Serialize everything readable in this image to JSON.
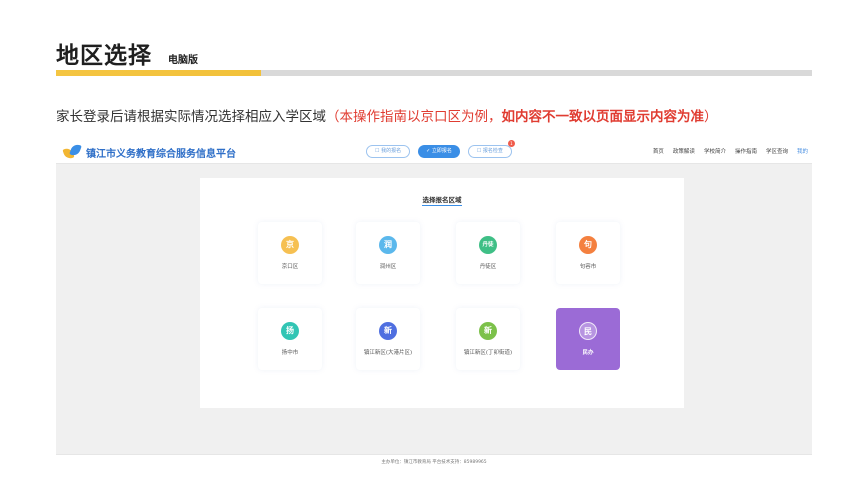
{
  "slide": {
    "title": "地区选择",
    "subtitle": "电脑版",
    "instruction_black": "家长登录后请根据实际情况选择相应入学区域",
    "instruction_red": "（本操作指南以京口区为例，",
    "instruction_red_bold": "如内容不一致以页面显示内容为准",
    "instruction_red_close": "）",
    "colors": {
      "accent_bar": "#f4c542",
      "red": "#e03c31"
    }
  },
  "app": {
    "brand": "镇江市义务教育综合服务信息平台",
    "pills": [
      {
        "label": "☐ 我的报名",
        "icon": "document-icon"
      },
      {
        "label": "✓ 立即报名",
        "icon": "check-icon"
      },
      {
        "label": "☐ 报名检查",
        "icon": "document-icon",
        "badge": "1"
      }
    ],
    "nav": [
      "首页",
      "政策解读",
      "学校简介",
      "操作指南",
      "学区查询",
      "我的"
    ],
    "card_title": "选择报名区域",
    "regions": [
      {
        "char": "京",
        "label": "京口区",
        "color": "#f6c052"
      },
      {
        "char": "润",
        "label": "润州区",
        "color": "#5bb8ec"
      },
      {
        "char": "丹徒",
        "label": "丹徒区",
        "color": "#3fbf86"
      },
      {
        "char": "句",
        "label": "句容市",
        "color": "#f4803f"
      },
      {
        "char": "扬",
        "label": "扬中市",
        "color": "#32c5b4"
      },
      {
        "char": "新",
        "label": "镇江新区(大港片区)",
        "color": "#4f6fe0"
      },
      {
        "char": "新",
        "label": "镇江新区(丁卯街道)",
        "color": "#7cc14a"
      },
      {
        "char": "民",
        "label": "民办",
        "color": "#9b6bd6"
      }
    ],
    "footer": "主办单位：镇江市教育局    平台技术支持：85989965"
  }
}
